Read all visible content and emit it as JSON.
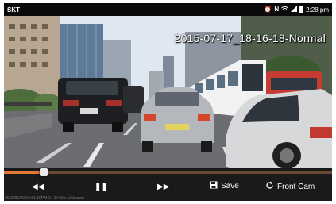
{
  "status_bar": {
    "carrier": "SKT",
    "time": "2:28 pm",
    "icons": [
      "alarm-icon",
      "nfc-icon",
      "wifi-icon",
      "signal-icon",
      "battery-icon"
    ]
  },
  "video": {
    "overlay_title": "2015-07-17_18-16-18-Normal"
  },
  "player": {
    "progress_fraction": 0.12,
    "accent_color": "#e07a33",
    "rewind_icon": "rewind-icon",
    "pause_icon": "pause-icon",
    "forward_icon": "fast-forward-icon",
    "save_label": "Save",
    "front_cam_label": "Front Cam"
  },
  "footer_info": "2015/05/20 04:51:50PM 14.1V Site Unknown"
}
